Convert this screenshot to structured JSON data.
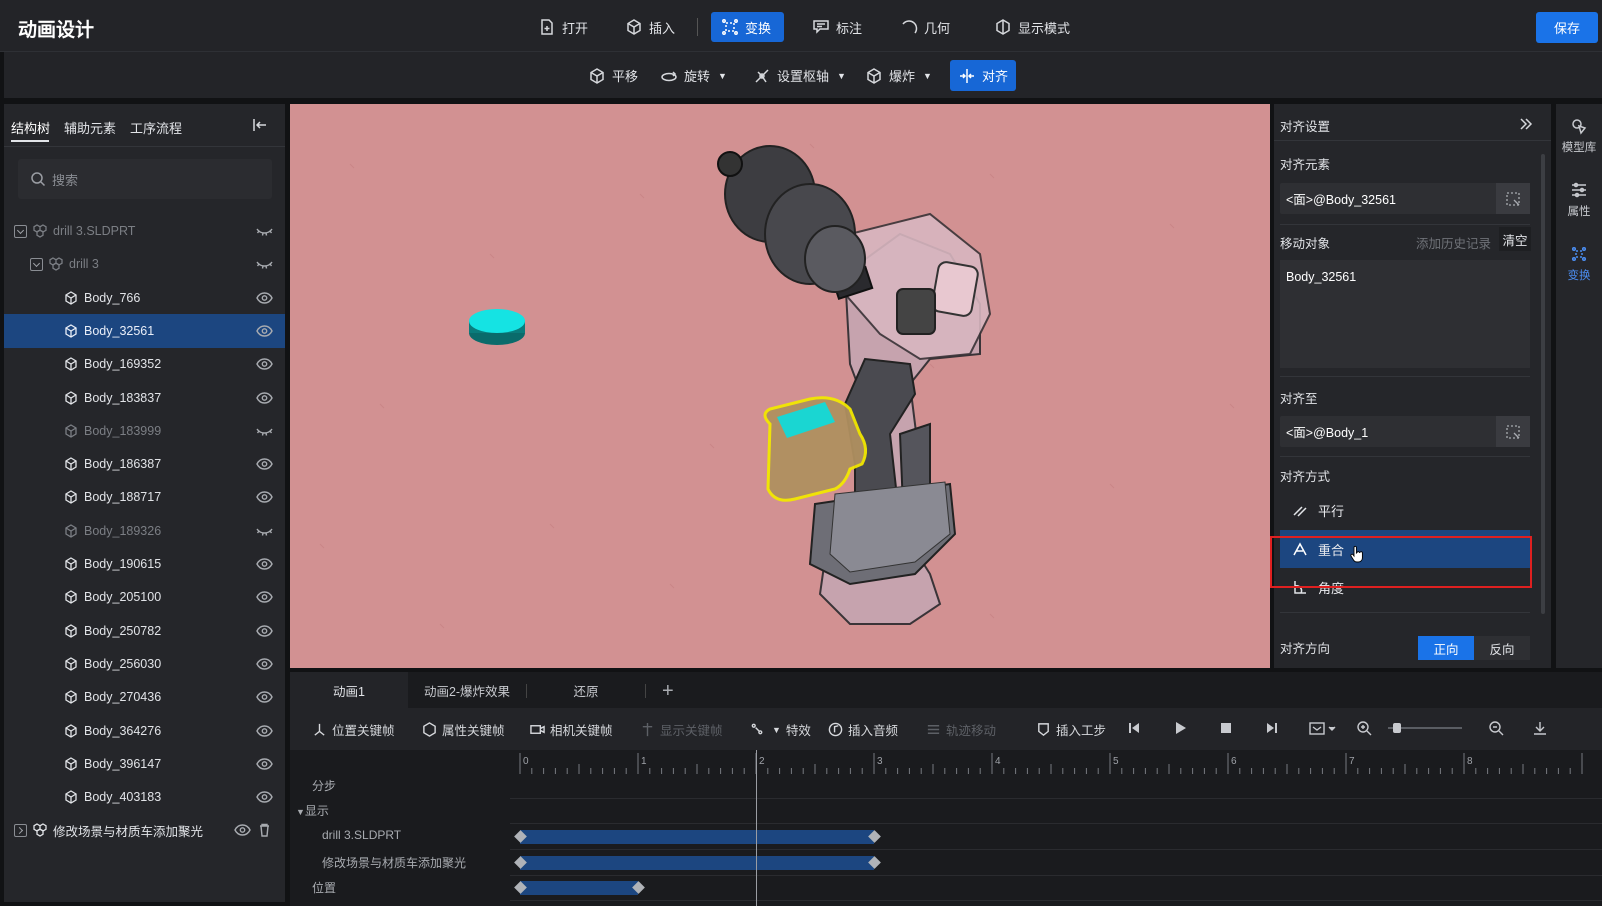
{
  "app": {
    "title": "动画设计",
    "save_label": "保存"
  },
  "toolbar": [
    {
      "label": "打开",
      "icon": "file-open-icon"
    },
    {
      "label": "插入",
      "icon": "cube-icon"
    },
    {
      "label": "变换",
      "icon": "transform-icon",
      "active": true
    },
    {
      "label": "标注",
      "icon": "annotation-icon"
    },
    {
      "label": "几何",
      "icon": "arc-icon"
    },
    {
      "label": "显示模式",
      "icon": "display-mode-icon"
    }
  ],
  "subtoolbar": [
    {
      "label": "平移",
      "icon": "translate-icon"
    },
    {
      "label": "旋转",
      "icon": "rotate-icon",
      "dropdown": true
    },
    {
      "label": "设置枢轴",
      "icon": "pivot-icon",
      "dropdown": true
    },
    {
      "label": "爆炸",
      "icon": "explode-icon",
      "dropdown": true
    },
    {
      "label": "对齐",
      "icon": "align-icon",
      "active": true
    }
  ],
  "left_panel": {
    "tabs": [
      "结构树",
      "辅助元素",
      "工序流程"
    ],
    "active_tab": "结构树",
    "search_placeholder": "搜索",
    "tree": [
      {
        "label": "drill 3.SLDPRT",
        "level": 0,
        "type": "assembly",
        "expanded": true,
        "visible": false
      },
      {
        "label": "drill 3",
        "level": 1,
        "type": "assembly",
        "expanded": true,
        "visible": false
      },
      {
        "label": "Body_766",
        "level": 2,
        "visible": true
      },
      {
        "label": "Body_32561",
        "level": 2,
        "visible": true,
        "selected": true
      },
      {
        "label": "Body_169352",
        "level": 2,
        "visible": true
      },
      {
        "label": "Body_183837",
        "level": 2,
        "visible": true
      },
      {
        "label": "Body_183999",
        "level": 2,
        "visible": false
      },
      {
        "label": "Body_186387",
        "level": 2,
        "visible": true
      },
      {
        "label": "Body_188717",
        "level": 2,
        "visible": true
      },
      {
        "label": "Body_189326",
        "level": 2,
        "visible": false
      },
      {
        "label": "Body_190615",
        "level": 2,
        "visible": true
      },
      {
        "label": "Body_205100",
        "level": 2,
        "visible": true
      },
      {
        "label": "Body_250782",
        "level": 2,
        "visible": true
      },
      {
        "label": "Body_256030",
        "level": 2,
        "visible": true
      },
      {
        "label": "Body_270436",
        "level": 2,
        "visible": true
      },
      {
        "label": "Body_364276",
        "level": 2,
        "visible": true
      },
      {
        "label": "Body_396147",
        "level": 2,
        "visible": true
      },
      {
        "label": "Body_403183",
        "level": 2,
        "visible": true
      },
      {
        "label": "修改场景与材质车添加聚光",
        "level": 0,
        "type": "assembly",
        "expanded": false,
        "visible": true,
        "deletable": true
      }
    ]
  },
  "right_panel": {
    "title": "对齐设置",
    "align_element_label": "对齐元素",
    "align_element_value": "<面>@Body_32561",
    "move_object_label": "移动对象",
    "add_history_label": "添加历史记录",
    "clear_label": "清空",
    "move_object_value": "Body_32561",
    "align_to_label": "对齐至",
    "align_to_value": "<面>@Body_1",
    "align_mode_label": "对齐方式",
    "modes": [
      {
        "label": "平行",
        "icon": "parallel-icon"
      },
      {
        "label": "重合",
        "icon": "coincident-icon",
        "selected": true
      },
      {
        "label": "角度",
        "icon": "angle-icon"
      }
    ],
    "direction_label": "对齐方向",
    "direction_options": [
      "正向",
      "反向"
    ],
    "direction_selected": "正向"
  },
  "right_rail": [
    {
      "label": "模型库",
      "icon": "model-library-icon"
    },
    {
      "label": "属性",
      "icon": "properties-icon"
    },
    {
      "label": "变换",
      "icon": "transform-icon",
      "active": true
    }
  ],
  "timeline": {
    "tabs": [
      "动画1",
      "动画2-爆炸效果",
      "还原"
    ],
    "active_tab": "动画1",
    "tools": [
      {
        "label": "位置关键帧",
        "icon": "position-key-icon",
        "enabled": true
      },
      {
        "label": "属性关键帧",
        "icon": "property-key-icon",
        "enabled": true
      },
      {
        "label": "相机关键帧",
        "icon": "camera-key-icon",
        "enabled": true
      },
      {
        "label": "显示关键帧",
        "icon": "display-key-icon",
        "enabled": false
      },
      {
        "label": "特效",
        "icon": "effects-icon",
        "enabled": true
      },
      {
        "label": "插入音频",
        "icon": "audio-icon",
        "enabled": true
      },
      {
        "label": "轨迹移动",
        "icon": "track-move-icon",
        "enabled": false
      },
      {
        "label": "插入工步",
        "icon": "step-icon",
        "enabled": true
      }
    ],
    "ruler_ticks": [
      "0",
      "1",
      "2",
      "3",
      "4",
      "5",
      "6",
      "7",
      "8"
    ],
    "playhead_time": 2,
    "rows": [
      {
        "label": "分步"
      },
      {
        "label": "显示",
        "group": true
      },
      {
        "label": "drill 3.SLDPRT",
        "start": 0,
        "end": 3
      },
      {
        "label": "修改场景与材质车添加聚光",
        "start": 0,
        "end": 3
      },
      {
        "label": "位置",
        "start": 0,
        "end": 1
      }
    ]
  }
}
